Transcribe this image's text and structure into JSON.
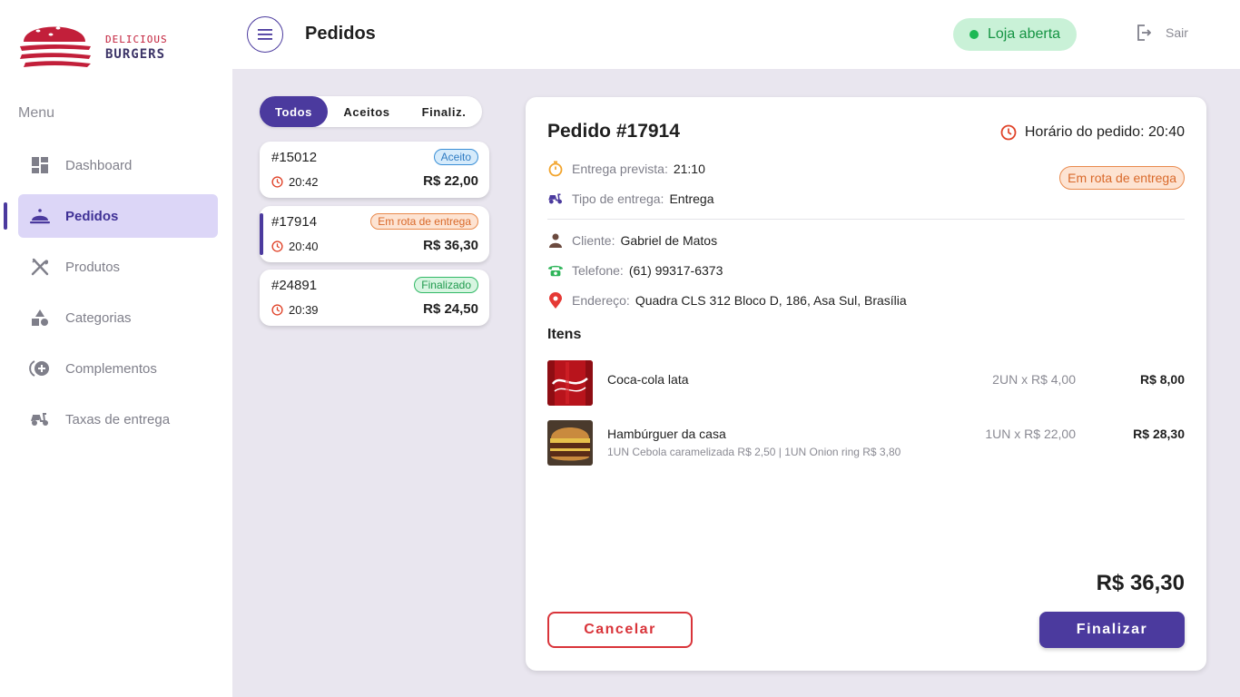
{
  "brand": {
    "line1": "DELICIOUS",
    "line2": "BURGERS"
  },
  "sidebar": {
    "menu_title": "Menu",
    "items": [
      {
        "label": "Dashboard",
        "icon": "dashboard-icon"
      },
      {
        "label": "Pedidos",
        "icon": "cloche-icon",
        "active": true
      },
      {
        "label": "Produtos",
        "icon": "utensils-icon"
      },
      {
        "label": "Categorias",
        "icon": "shapes-icon"
      },
      {
        "label": "Complementos",
        "icon": "add-circle-icon"
      },
      {
        "label": "Taxas de entrega",
        "icon": "scooter-icon"
      }
    ]
  },
  "header": {
    "title": "Pedidos",
    "store_status": "Loja aberta",
    "logout_label": "Sair"
  },
  "filters": {
    "tabs": [
      "Todos",
      "Aceitos",
      "Finaliz."
    ],
    "selected": "Todos"
  },
  "orders": [
    {
      "number": "#15012",
      "status": "Aceito",
      "time": "20:42",
      "price": "R$ 22,00"
    },
    {
      "number": "#17914",
      "status": "Em rota de entrega",
      "time": "20:40",
      "price": "R$ 36,30",
      "selected": true
    },
    {
      "number": "#24891",
      "status": "Finalizado",
      "time": "20:39",
      "price": "R$ 24,50"
    }
  ],
  "details": {
    "title": "Pedido #17914",
    "order_time": "Horário do pedido: 20:40",
    "status": "Em rota de entrega",
    "eta_label": "Entrega prevista:",
    "eta_value": "21:10",
    "delivery_type_label": "Tipo de entrega:",
    "delivery_type_value": "Entrega",
    "client_label": "Cliente:",
    "client_value": "Gabriel de Matos",
    "phone_label": "Telefone:",
    "phone_value": "(61) 99317-6373",
    "address_label": "Endereço:",
    "address_value": "Quadra CLS 312 Bloco D, 186, Asa Sul, Brasília",
    "items_title": "Itens",
    "items": [
      {
        "name": "Coca-cola lata",
        "qty": "2UN x R$ 4,00",
        "total": "R$ 8,00",
        "extras": ""
      },
      {
        "name": "Hambúrguer da casa",
        "qty": "1UN x R$ 22,00",
        "total": "R$ 28,30",
        "extras": "1UN Cebola caramelizada R$ 2,50 | 1UN Onion ring R$ 3,80"
      }
    ],
    "total": "R$ 36,30",
    "cancel_label": "Cancelar",
    "finish_label": "Finalizar"
  },
  "colors": {
    "primary": "#4b3a9e",
    "brand_red": "#c21f3a",
    "open_green": "#1db954",
    "cancel_red": "#d9343a"
  }
}
